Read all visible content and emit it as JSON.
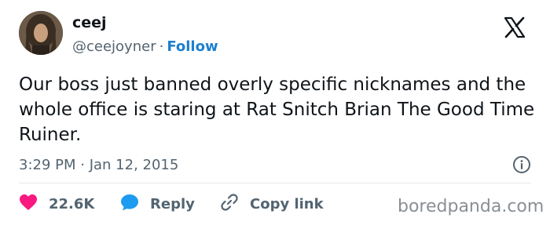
{
  "author": {
    "name": "ceej",
    "handle": "@ceejoyner",
    "separator": "·",
    "follow_label": "Follow"
  },
  "tweet": {
    "text": "Our boss just banned overly specific nicknames and the whole office is staring at Rat Snitch Brian The Good Time Ruiner.",
    "timestamp": "3:29 PM · Jan 12, 2015"
  },
  "actions": {
    "likes_count": "22.6K",
    "reply_label": "Reply",
    "copy_link_label": "Copy link"
  },
  "icons": {
    "platform": "x-logo-icon",
    "info": "info-icon",
    "like": "heart-icon",
    "reply": "speech-bubble-icon",
    "copy": "link-icon"
  },
  "colors": {
    "text": "#0f1419",
    "secondary": "#536471",
    "follow": "#1d7fd0",
    "like": "#f91880",
    "reply": "#1d9bf0",
    "watermark": "#8a8f95"
  },
  "watermark": "boredpanda.com"
}
